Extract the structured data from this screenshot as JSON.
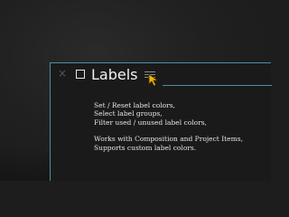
{
  "panel": {
    "tab": {
      "close_icon": "close-icon",
      "close_glyph": "×",
      "checkbox_icon": "checkbox-icon",
      "title": "Labels",
      "menu_icon": "hamburger-menu-icon",
      "accent_color": "#4f8ea1"
    },
    "features": [
      "Set / Reset label colors,",
      "Select label groups,",
      "Filter used / unused label colors,"
    ],
    "notes": [
      "Works with Composition and Project Items,",
      "Supports custom label colors."
    ]
  },
  "cursor": {
    "icon": "mouse-pointer-icon",
    "color": "#f0b400"
  }
}
